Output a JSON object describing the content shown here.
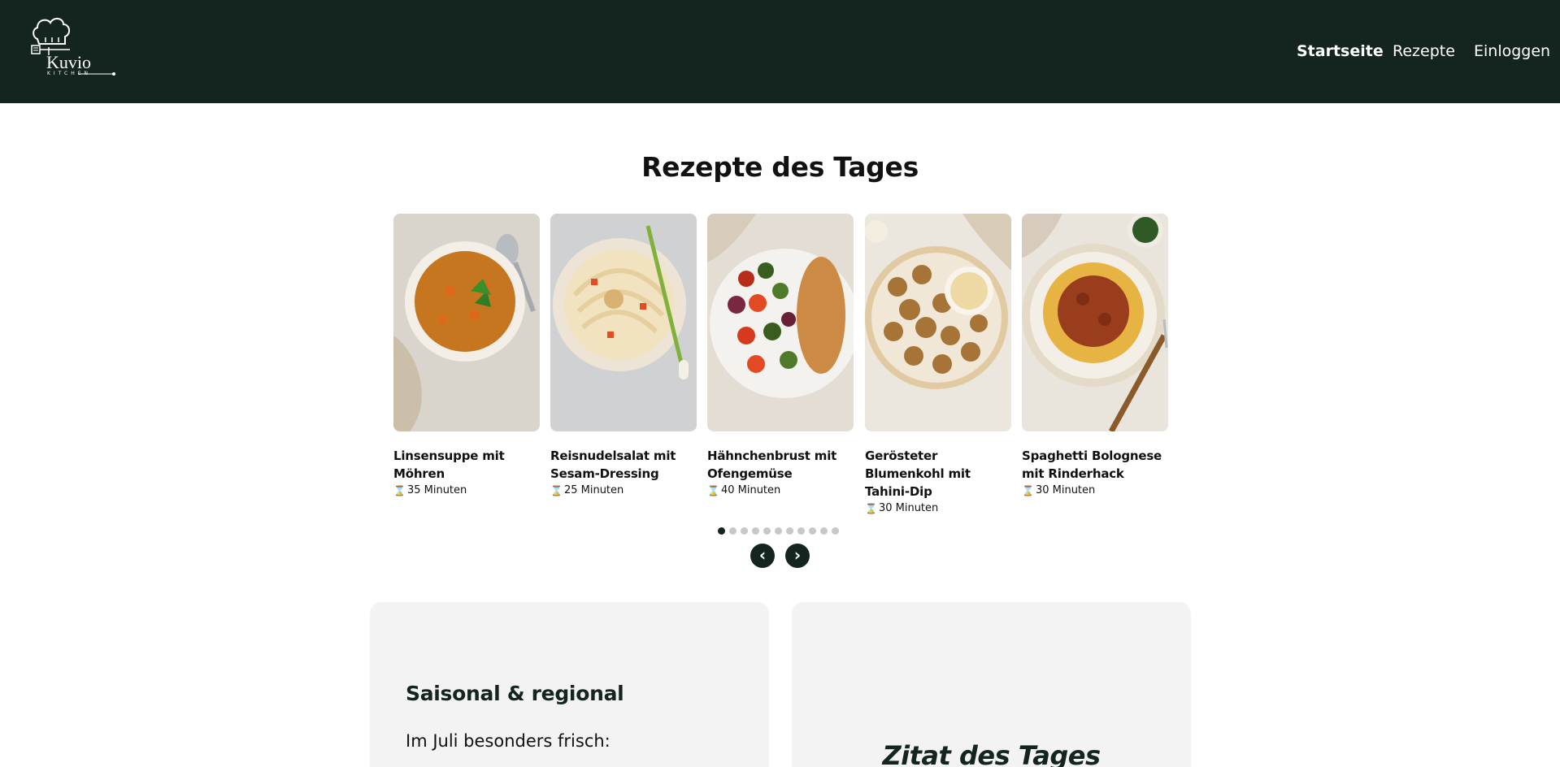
{
  "brand": {
    "name": "Kuvio",
    "sub": "KITCHEN"
  },
  "nav": {
    "home": "Startseite",
    "recipes": "Rezepte",
    "login": "Einloggen"
  },
  "section_title": "Rezepte des Tages",
  "cards": [
    {
      "title": "Linsensuppe mit Möhren",
      "time": "35 Minuten",
      "image": "lentil-soup"
    },
    {
      "title": "Reisnudelsalat mit Sesam-Dressing",
      "time": "25 Minuten",
      "image": "rice-noodle-salad"
    },
    {
      "title": "Hähnchenbrust mit Ofengemüse",
      "time": "40 Minuten",
      "image": "chicken-vegetables"
    },
    {
      "title": "Gerösteter Blumenkohl mit Tahini-Dip",
      "time": "30 Minuten",
      "image": "roasted-cauliflower"
    },
    {
      "title": "Spaghetti Bolognese mit Rinderhack",
      "time": "30 Minuten",
      "image": "spaghetti-bolognese"
    }
  ],
  "carousel": {
    "total": 11,
    "active": 0,
    "prev": "‹",
    "next": "›"
  },
  "seasonal": {
    "title": "Saisonal & regional",
    "text": "Im Juli besonders frisch:"
  },
  "quote": {
    "title": "Zitat des Tages"
  },
  "colors": {
    "header_bg": "#142520",
    "accent": "#142520",
    "box_bg": "#f3f3f3"
  }
}
